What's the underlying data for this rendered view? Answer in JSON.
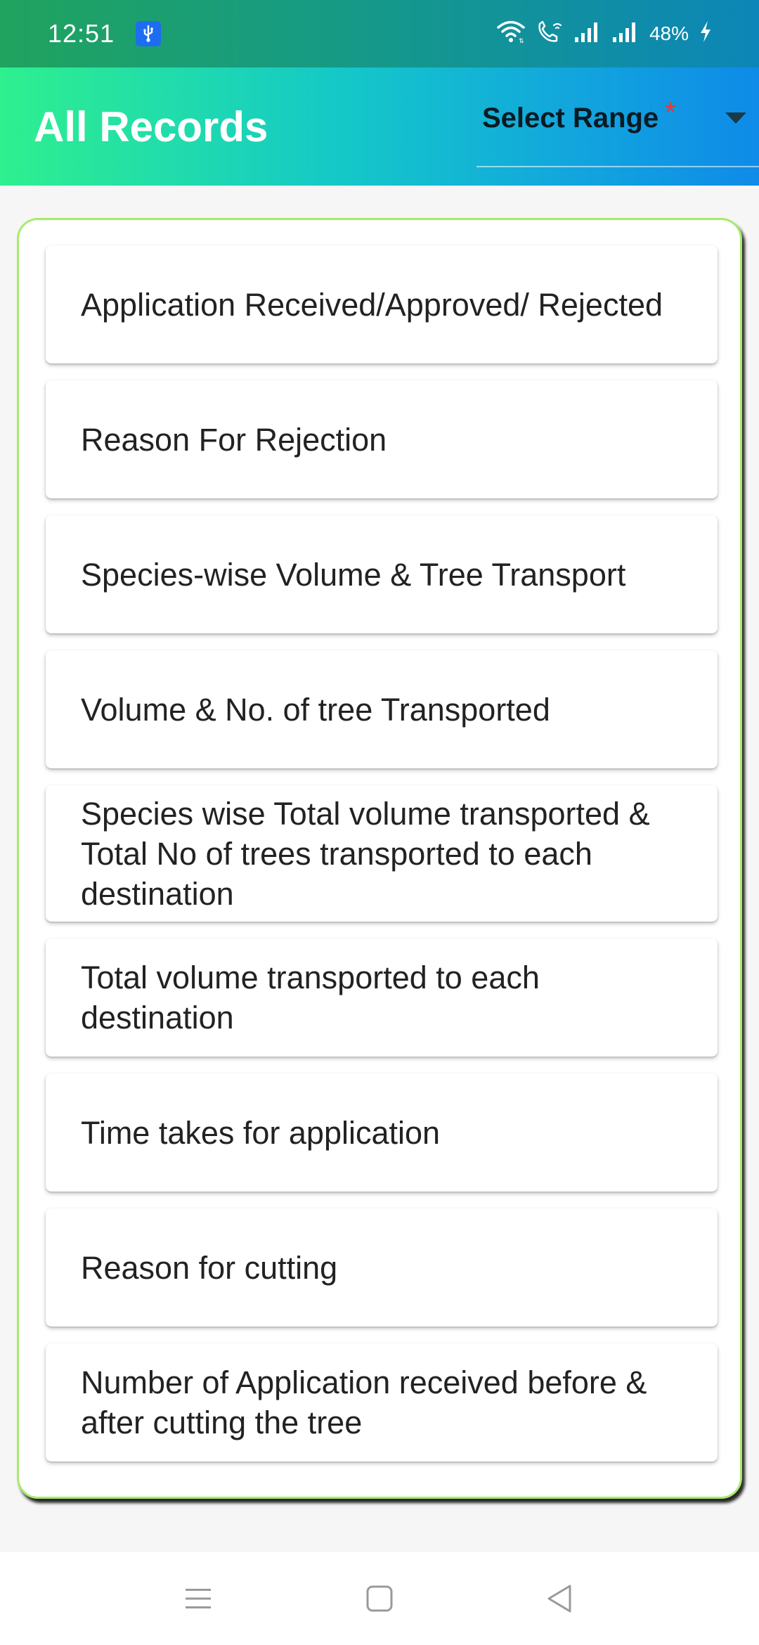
{
  "status_bar": {
    "time": "12:51",
    "battery_percent": "48%"
  },
  "app_bar": {
    "title": "All Records",
    "range_select": {
      "label": "Select Range",
      "required_mark": "*"
    }
  },
  "records": [
    {
      "label": "Application Received/Approved/ Rejected"
    },
    {
      "label": "Reason For Rejection"
    },
    {
      "label": "Species-wise Volume & Tree Transport"
    },
    {
      "label": "Volume & No. of tree Transported"
    },
    {
      "label": "Species wise Total volume transported & Total  No of trees transported to each destination"
    },
    {
      "label": "Total volume transported to each destination"
    },
    {
      "label": "Time takes for application"
    },
    {
      "label": "Reason for cutting"
    },
    {
      "label": "Number of Application received before & after cutting the tree"
    }
  ],
  "colors": {
    "accent_start": "#2ef08e",
    "accent_end": "#0e8be8",
    "panel_border": "#a5ec6a",
    "required": "#e53935"
  },
  "icons": {
    "status": [
      "usb-icon",
      "wifi-icon",
      "wifi-calling-icon",
      "signal-icon",
      "signal-icon",
      "charging-icon"
    ],
    "nav": [
      "recent-apps-icon",
      "home-icon",
      "back-icon"
    ]
  }
}
